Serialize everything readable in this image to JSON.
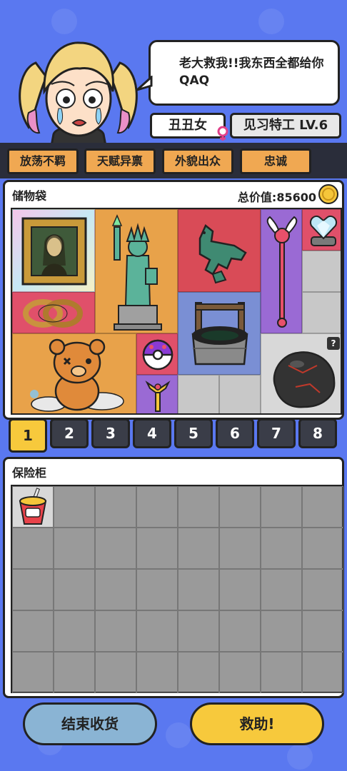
{
  "dialog": {
    "speech": "老大救我!!我东西全都给你QAQ"
  },
  "character": {
    "name": "丑丑女",
    "level": "见习特工 LV.6"
  },
  "traits": [
    "放荡不羁",
    "天赋异禀",
    "外貌出众",
    "忠诚"
  ],
  "storage": {
    "title": "储物袋",
    "value_label": "总价值:85600",
    "unknown_badge": "?"
  },
  "tabs": [
    "1",
    "2",
    "3",
    "4",
    "5",
    "6",
    "7",
    "8"
  ],
  "active_tab": "1",
  "safe": {
    "title": "保险柜",
    "columns": 8,
    "rows": 5
  },
  "buttons": {
    "end": "结束收货",
    "rescue": "救助!"
  },
  "colors": {
    "background": "#5a78f0",
    "accent_yellow": "#f7c93c",
    "trait_orange": "#f0a852",
    "end_button": "#8ab4d4"
  },
  "items": [
    "mona-lisa-painting",
    "statue-of-liberty",
    "bronze-horse",
    "winged-wand",
    "diamond-heart-ring",
    "rope",
    "teddy-bear",
    "monster-ball",
    "old-well",
    "coal-rock",
    "magic-pendant",
    "instant-noodles"
  ]
}
